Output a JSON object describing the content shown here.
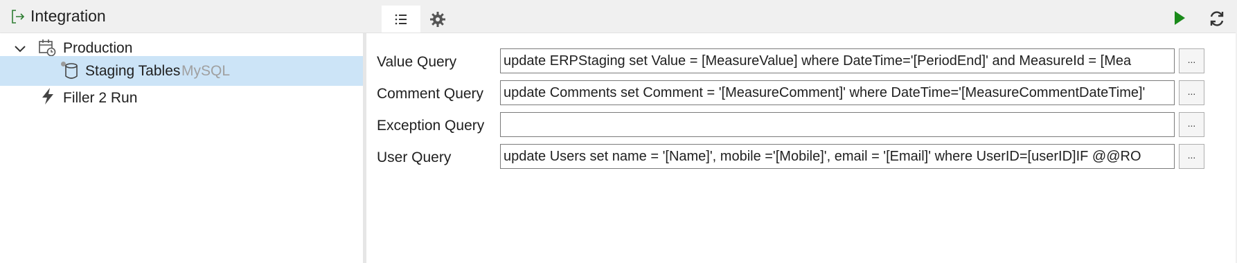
{
  "left_header": {
    "title": "Integration",
    "icon": "exit-arrow-icon"
  },
  "tree": {
    "items": [
      {
        "label": "Production",
        "icon": "calendar-clock-icon",
        "expander": "chevron-down-icon"
      },
      {
        "label": "Staging Tables",
        "sublabel": "MySQL",
        "icon": "database-icon",
        "selected": true
      },
      {
        "label": "Filler 2 Run",
        "icon": "lightning-icon"
      }
    ]
  },
  "right_header": {
    "tabs": [
      {
        "name": "list",
        "icon": "list-icon",
        "active": true
      },
      {
        "name": "settings",
        "icon": "gear-icon",
        "active": false
      }
    ],
    "run_icon": "play-icon",
    "refresh_icon": "refresh-icon"
  },
  "form": {
    "fields": [
      {
        "label": "Value Query",
        "value": "update ERPStaging set Value = [MeasureValue] where DateTime='[PeriodEnd]' and MeasureId = [Mea",
        "button": "..."
      },
      {
        "label": "Comment Query",
        "value": "update Comments set Comment = '[MeasureComment]' where DateTime='[MeasureCommentDateTime]'",
        "button": "..."
      },
      {
        "label": "Exception Query",
        "value": "",
        "button": "..."
      },
      {
        "label": "User Query",
        "value": "update Users set name = '[Name]', mobile ='[Mobile]', email = '[Email]' where UserID=[userID]IF @@RO",
        "button": "..."
      }
    ]
  },
  "colors": {
    "header_bg": "#f0f0f0",
    "selected_row": "#cce4f7",
    "run_green": "#1a8a1a",
    "sublabel_gray": "#a0a0a0"
  }
}
